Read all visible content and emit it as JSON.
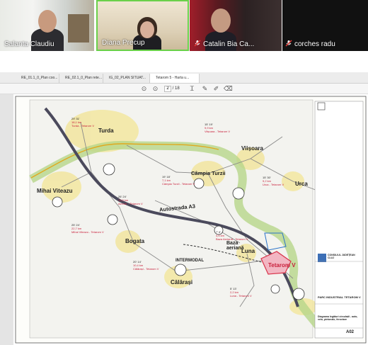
{
  "participants": [
    {
      "name": "Salanta Claudiu",
      "muted": false
    },
    {
      "name": "Diana Precup",
      "muted": false
    },
    {
      "name": "Catalin Bia Ca...",
      "muted": true
    },
    {
      "name": "corches radu",
      "muted": true
    }
  ],
  "tabs": [
    {
      "label": "RE_01.1_0_Plan coo..."
    },
    {
      "label": "RE_02.1_0_Plan rete..."
    },
    {
      "label": "IG_02_PLAN SITUAT..."
    },
    {
      "label": "Tetarom 5 - Harta u..."
    }
  ],
  "toolbar": {
    "page_current": "2",
    "page_total": "/ 18"
  },
  "map": {
    "cities": [
      "Turda",
      "Viișoara",
      "Câmpia Turzii",
      "Urca",
      "Mihai Viteazu",
      "Bogata",
      "Călărași",
      "Luna",
      "Tetarom V"
    ],
    "labels": {
      "highway": "Autostrada A3",
      "intermodal": "INTERMODAL",
      "airport": "Baza aeriană"
    },
    "distances": [
      {
        "value": "18,1 km",
        "route": "Turda - Tetarom V"
      },
      {
        "value": "9,9 km",
        "route": "Viișoara - Tetarom V"
      },
      {
        "value": "7,1 km",
        "route": "Câmpia Turzii - Tetarom V"
      },
      {
        "value": "9,2 km",
        "route": "Urca - Tetarom V"
      },
      {
        "value": "13,3 km",
        "route": "Aerodr. - Tetarom V"
      },
      {
        "value": "22,7 km",
        "route": "Mihai Viteazu - Tetarom V"
      },
      {
        "value": "4,5 km",
        "route": "Baza Aeriană - Tetarom V"
      },
      {
        "value": "10,4 km",
        "route": "Călărași - Tetarom V"
      },
      {
        "value": "2,2 km",
        "route": "Luna - Tetarom V"
      }
    ],
    "times": [
      {
        "a": "29'",
        "b": "31'"
      },
      {
        "a": "15'",
        "b": "19'"
      },
      {
        "a": "19'",
        "b": "18'"
      },
      {
        "a": "15'",
        "b": "30'"
      },
      {
        "a": "26'",
        "b": "24'"
      },
      {
        "a": "25'",
        "b": "24'"
      },
      {
        "a": "7'",
        "b": "6'"
      },
      {
        "a": "20'",
        "b": "14'"
      },
      {
        "a": "5'",
        "b": "13'"
      }
    ],
    "title_block": {
      "client": "CONSILIUL JUDEȚEAN CLUJ",
      "project": "PARC INDUSTRIAL TETAROM V",
      "drawing": "Diagrama legături circulații - auto, velo, pietonale, feroviare",
      "sheet": "A02"
    }
  }
}
